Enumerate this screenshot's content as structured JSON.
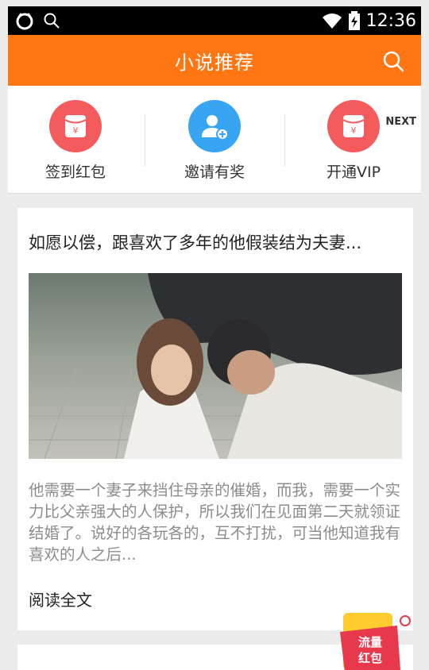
{
  "status_bar": {
    "time": "12:36"
  },
  "header": {
    "title": "小说推荐"
  },
  "actions": [
    {
      "label": "签到红包",
      "icon": "red-envelope-icon",
      "color": "#f35b5d"
    },
    {
      "label": "邀请有奖",
      "icon": "invite-user-icon",
      "color": "#37a5f2"
    },
    {
      "label": "开通VIP",
      "icon": "red-envelope-icon",
      "color": "#f35b5d"
    }
  ],
  "actions_next": "NEXT",
  "article": {
    "title": "如愿以偿，跟喜欢了多年的他假装结为夫妻...",
    "excerpt": "他需要一个妻子来挡住母亲的催婚，而我，需要一个实力比父亲强大的人保护，所以我们在见面第二天就领证结婚了。说好的各玩各的，互不打扰，可当他知道我有喜欢的人之后...",
    "read_more": "阅读全文"
  },
  "float_packet": {
    "text": "流量红包"
  },
  "colors": {
    "accent": "#ff7613",
    "red": "#f35b5d",
    "blue": "#37a5f2"
  }
}
